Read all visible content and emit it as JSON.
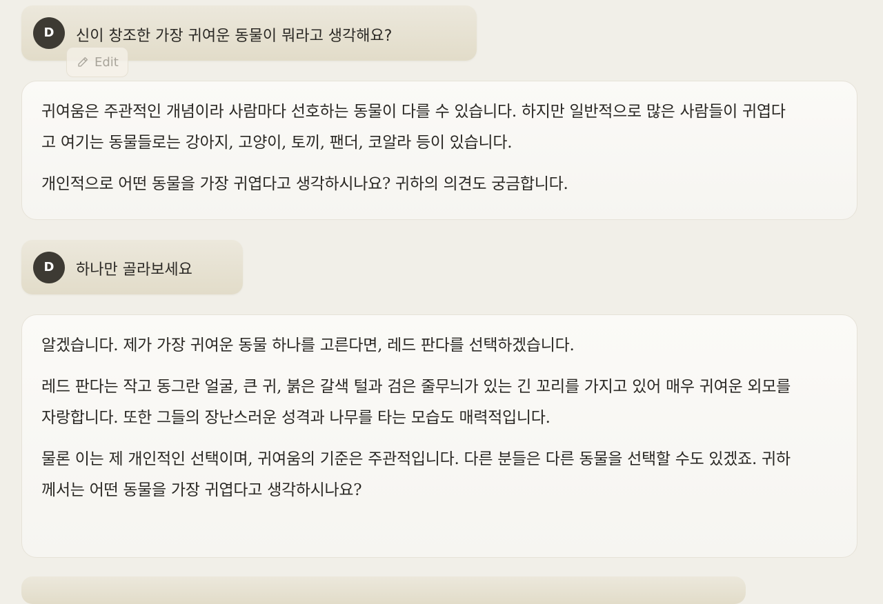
{
  "conversation": {
    "messages": [
      {
        "role": "user",
        "avatar_letter": "D",
        "text": "신이 창조한 가장 귀여운 동물이 뭐라고 생각해요?",
        "edit_label": "Edit"
      },
      {
        "role": "assistant",
        "paragraphs": [
          "귀여움은 주관적인 개념이라 사람마다 선호하는 동물이 다를 수 있습니다. 하지만 일반적으로 많은 사람들이 귀엽다고 여기는 동물들로는 강아지, 고양이, 토끼, 팬더, 코알라 등이 있습니다.",
          "개인적으로 어떤 동물을 가장 귀엽다고 생각하시나요? 귀하의 의견도 궁금합니다."
        ]
      },
      {
        "role": "user",
        "avatar_letter": "D",
        "text": "하나만 골라보세요"
      },
      {
        "role": "assistant",
        "paragraphs": [
          "알겠습니다. 제가 가장 귀여운 동물 하나를 고른다면, 레드 판다를 선택하겠습니다.",
          "레드 판다는 작고 동그란 얼굴, 큰 귀, 붉은 갈색 털과 검은 줄무늬가 있는 긴 꼬리를 가지고 있어 매우 귀여운 외모를 자랑합니다. 또한 그들의 장난스러운 성격과 나무를 타는 모습도 매력적입니다.",
          "물론 이는 제 개인적인 선택이며, 귀여움의 기준은 주관적입니다. 다른 분들은 다른 동물을 선택할 수도 있겠죠. 귀하께서는 어떤 동물을 가장 귀엽다고 생각하시나요?"
        ]
      }
    ]
  },
  "icons": {
    "edit": "pencil-icon"
  },
  "colors": {
    "background": "#f1efe8",
    "user_bubble": "#e6e1d2",
    "assistant_bubble": "#f9f8f4",
    "avatar": "#3d3a33",
    "text": "#2a2824"
  }
}
